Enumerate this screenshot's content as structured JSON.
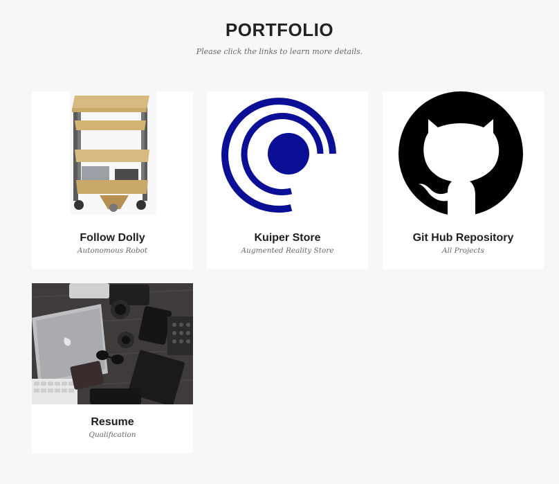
{
  "header": {
    "title": "PORTFOLIO",
    "subtitle": "Please click the links to learn more details."
  },
  "cards": [
    {
      "title": "Follow Dolly",
      "subtitle": "Autonomous Robot",
      "image": "robot-cart-render"
    },
    {
      "title": "Kuiper Store",
      "subtitle": "Augmented Reality Store",
      "image": "kuiper-logo"
    },
    {
      "title": "Git Hub Repository",
      "subtitle": "All Projects",
      "image": "github-octocat-logo"
    },
    {
      "title": "Resume",
      "subtitle": "Qualification",
      "image": "desk-laptop-camera-photo"
    }
  ],
  "colors": {
    "background": "#f6f7f9",
    "card": "#ffffff",
    "kuiper_blue": "#0a0f96",
    "github_black": "#000000"
  }
}
